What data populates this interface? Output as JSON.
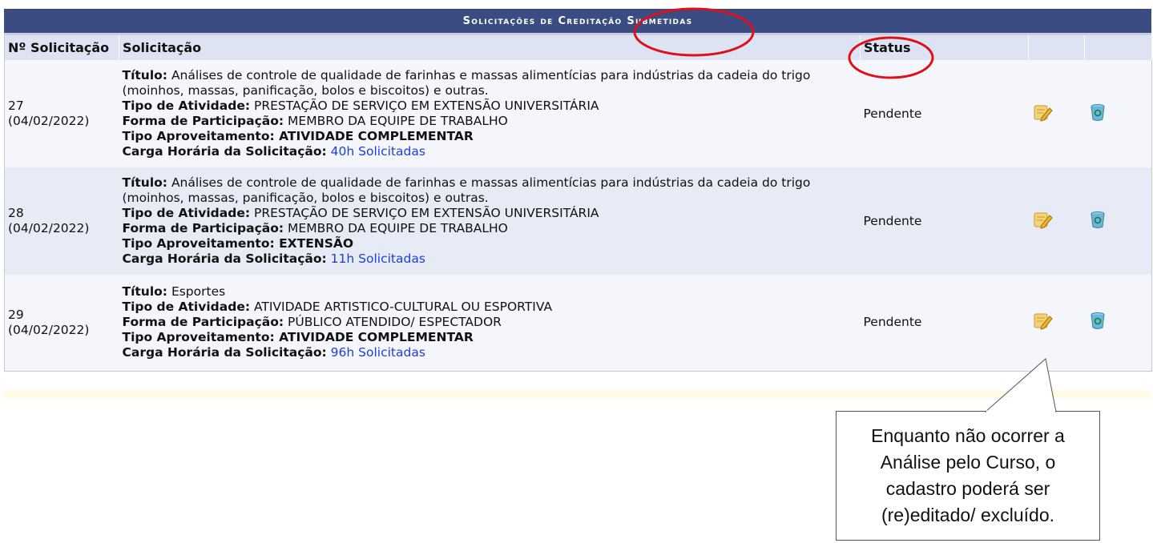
{
  "panel": {
    "title": "Solicitações de Creditação Submetidas",
    "columns": {
      "numero": "Nº Solicitação",
      "solicitacao": "Solicitação",
      "status": "Status"
    }
  },
  "rows": [
    {
      "numero": "27",
      "data": "(04/02/2022)",
      "titulo_label": "Título:",
      "titulo": "Análises de controle de qualidade de farinhas e massas alimentícias para indústrias da cadeia do trigo (moinhos, massas, panificação, bolos e biscoitos) e outras.",
      "tipo_atividade_label": "Tipo de Atividade:",
      "tipo_atividade": "PRESTAÇÃO DE SERVIÇO EM EXTENSÃO UNIVERSITÁRIA",
      "forma_label": "Forma de Participação:",
      "forma": "MEMBRO DA EQUIPE DE TRABALHO",
      "aproveitamento_label": "Tipo Aproveitamento:",
      "aproveitamento": "ATIVIDADE COMPLEMENTAR",
      "carga_label": "Carga Horária da Solicitação:",
      "carga": "40h Solicitadas",
      "status": "Pendente"
    },
    {
      "numero": "28",
      "data": "(04/02/2022)",
      "titulo_label": "Título:",
      "titulo": "Análises de controle de qualidade de farinhas e massas alimentícias para indústrias da cadeia do trigo (moinhos, massas, panificação, bolos e biscoitos) e outras.",
      "tipo_atividade_label": "Tipo de Atividade:",
      "tipo_atividade": "PRESTAÇÃO DE SERVIÇO EM EXTENSÃO UNIVERSITÁRIA",
      "forma_label": "Forma de Participação:",
      "forma": "MEMBRO DA EQUIPE DE TRABALHO",
      "aproveitamento_label": "Tipo Aproveitamento:",
      "aproveitamento": "EXTENSÃO",
      "carga_label": "Carga Horária da Solicitação:",
      "carga": "11h Solicitadas",
      "status": "Pendente"
    },
    {
      "numero": "29",
      "data": "(04/02/2022)",
      "titulo_label": "Título:",
      "titulo": "Esportes",
      "tipo_atividade_label": "Tipo de Atividade:",
      "tipo_atividade": "ATIVIDADE ARTISTICO-CULTURAL OU ESPORTIVA",
      "forma_label": "Forma de Participação:",
      "forma": "PÚBLICO ATENDIDO/ ESPECTADOR",
      "aproveitamento_label": "Tipo Aproveitamento:",
      "aproveitamento": "ATIVIDADE COMPLEMENTAR",
      "carga_label": "Carga Horária da Solicitação:",
      "carga": "96h Solicitadas",
      "status": "Pendente"
    }
  ],
  "icons": {
    "edit": "edit-icon",
    "delete": "trash-icon"
  },
  "callout": {
    "text": "Enquanto não ocorrer a Análise pelo Curso, o cadastro poderá ser (re)editado/ excluído."
  },
  "colors": {
    "header_bar": "#3a4c82",
    "column_header": "#dde3f2",
    "link": "#1f3fd1",
    "highlight_ellipse": "#e0101a"
  }
}
